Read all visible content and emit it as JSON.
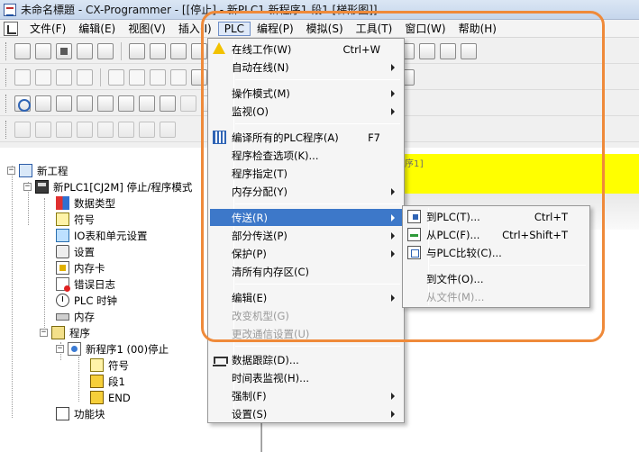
{
  "title_bar": {
    "text": "未命名標題 - CX-Programmer - [[停止] - 新PLC1.新程序1.段1 [梯形图]]"
  },
  "menu_bar": {
    "items": [
      {
        "label": "文件(F)"
      },
      {
        "label": "编辑(E)"
      },
      {
        "label": "视图(V)"
      },
      {
        "label": "插入(I)"
      },
      {
        "label": "PLC"
      },
      {
        "label": "编程(P)"
      },
      {
        "label": "模拟(S)"
      },
      {
        "label": "工具(T)"
      },
      {
        "label": "窗口(W)"
      },
      {
        "label": "帮助(H)"
      }
    ]
  },
  "editor": {
    "hint": "序1]"
  },
  "project_tree": {
    "items": [
      {
        "label": "新工程"
      },
      {
        "label": "新PLC1[CJ2M] 停止/程序模式"
      },
      {
        "label": "数据类型"
      },
      {
        "label": "符号"
      },
      {
        "label": "IO表和单元设置"
      },
      {
        "label": "设置"
      },
      {
        "label": "内存卡"
      },
      {
        "label": "错误日志"
      },
      {
        "label": "PLC 时钟"
      },
      {
        "label": "内存"
      },
      {
        "label": "程序"
      },
      {
        "label": "新程序1 (00)停止"
      },
      {
        "label": "符号"
      },
      {
        "label": "段1"
      },
      {
        "label": "END"
      },
      {
        "label": "功能块"
      }
    ]
  },
  "plc_menu": {
    "items": [
      {
        "label": "在线工作(W)",
        "shortcut": "Ctrl+W"
      },
      {
        "label": "自动在线(N)"
      },
      {
        "label": "操作模式(M)"
      },
      {
        "label": "监视(O)"
      },
      {
        "label": "编译所有的PLC程序(A)",
        "shortcut": "F7"
      },
      {
        "label": "程序检查选项(K)..."
      },
      {
        "label": "程序指定(T)"
      },
      {
        "label": "内存分配(Y)"
      },
      {
        "label": "传送(R)"
      },
      {
        "label": "部分传送(P)"
      },
      {
        "label": "保护(P)"
      },
      {
        "label": "清所有内存区(C)"
      },
      {
        "label": "编辑(E)"
      },
      {
        "label": "改变机型(G)"
      },
      {
        "label": "更改通信设置(U)"
      },
      {
        "label": "数据跟踪(D)..."
      },
      {
        "label": "时间表监视(H)..."
      },
      {
        "label": "强制(F)"
      },
      {
        "label": "设置(S)"
      }
    ]
  },
  "transfer_submenu": {
    "items": [
      {
        "label": "到PLC(T)...",
        "shortcut": "Ctrl+T"
      },
      {
        "label": "从PLC(F)...",
        "shortcut": "Ctrl+Shift+T"
      },
      {
        "label": "与PLC比较(C)..."
      },
      {
        "label": "到文件(O)..."
      },
      {
        "label": "从文件(M)..."
      }
    ]
  }
}
